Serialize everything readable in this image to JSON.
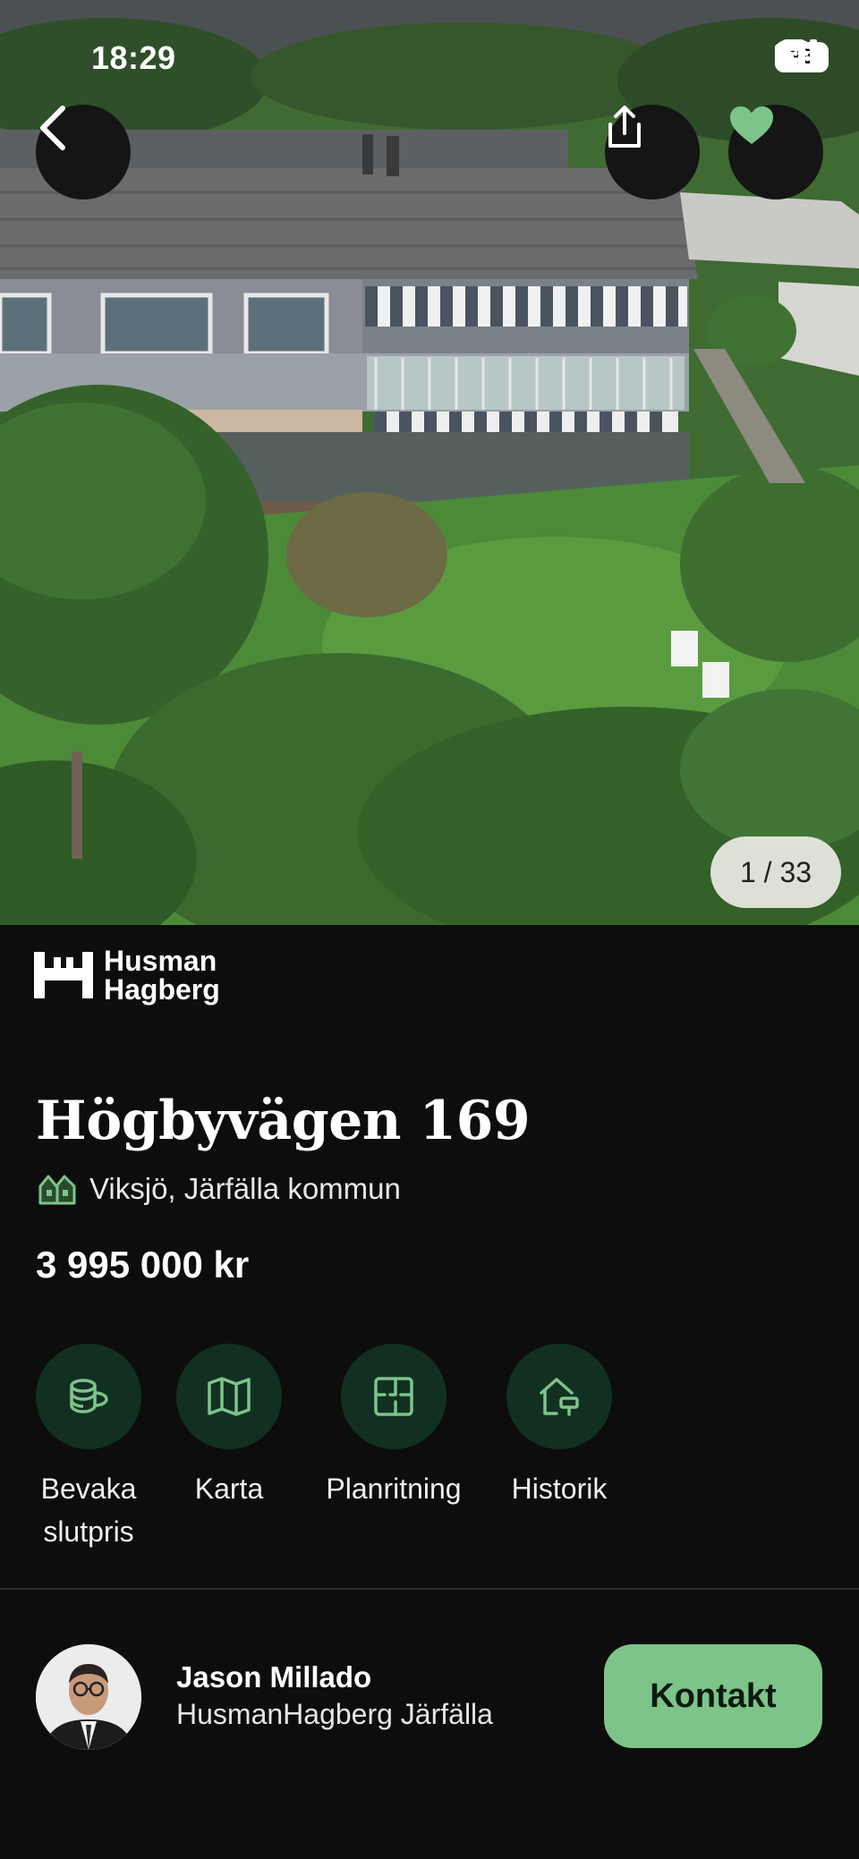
{
  "status_bar": {
    "time": "18:29",
    "battery": "95"
  },
  "gallery": {
    "counter": "1 / 33"
  },
  "brand": {
    "line1": "Husman",
    "line2": "Hagberg"
  },
  "listing": {
    "title": "Högbyvägen 169",
    "location": "Viksjö, Järfälla kommun",
    "price": "3 995 000 kr"
  },
  "actions": [
    {
      "label": "Bevaka slutpris",
      "icon": "coins-icon"
    },
    {
      "label": "Karta",
      "icon": "map-icon"
    },
    {
      "label": "Planritning",
      "icon": "floorplan-icon"
    },
    {
      "label": "Historik",
      "icon": "house-history-icon"
    }
  ],
  "agent": {
    "name": "Jason Millado",
    "office": "HusmanHagberg Järfälla",
    "contact_label": "Kontakt"
  },
  "colors": {
    "accent": "#7cc48a",
    "action_bg": "#123021",
    "background": "#0d0d0d",
    "favorite": "#7cc48a"
  }
}
